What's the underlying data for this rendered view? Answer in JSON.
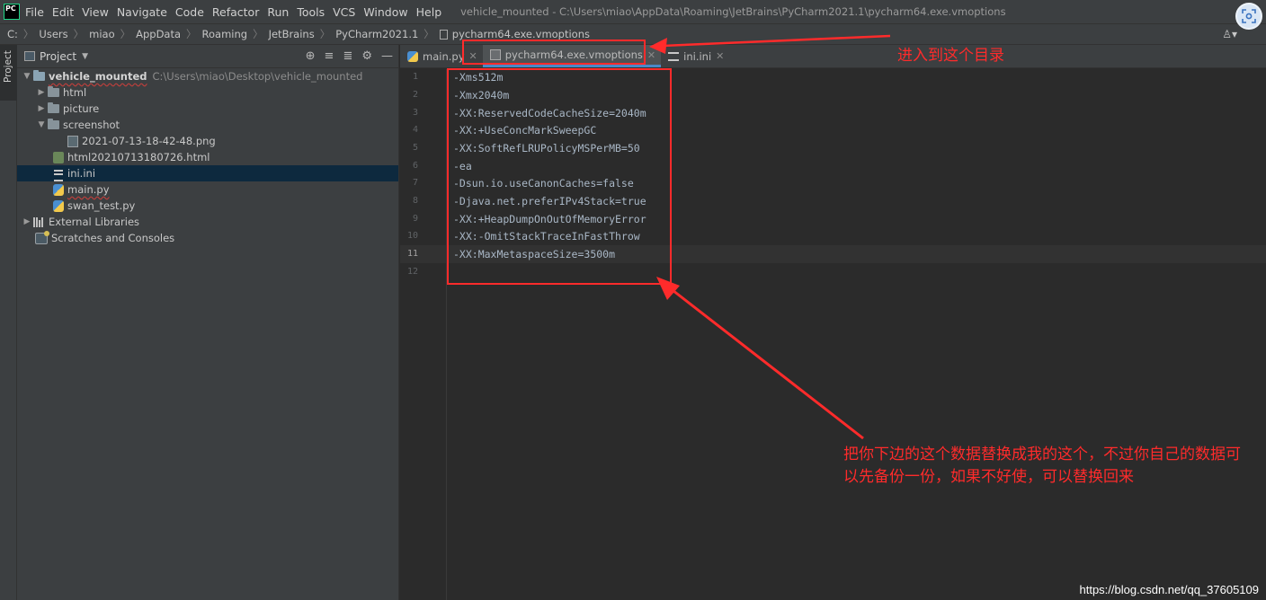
{
  "menubar": {
    "logo_text": "PC",
    "items": [
      "File",
      "Edit",
      "View",
      "Navigate",
      "Code",
      "Refactor",
      "Run",
      "Tools",
      "VCS",
      "Window",
      "Help"
    ],
    "window_title": "vehicle_mounted - C:\\Users\\miao\\AppData\\Roaming\\JetBrains\\PyCharm2021.1\\pycharm64.exe.vmoptions"
  },
  "breadcrumb": [
    "C:",
    "Users",
    "miao",
    "AppData",
    "Roaming",
    "JetBrains",
    "PyCharm2021.1",
    "pycharm64.exe.vmoptions"
  ],
  "tool_stripe": {
    "project_tab": "Project"
  },
  "project_panel": {
    "title": "Project",
    "root": {
      "name": "vehicle_mounted",
      "path": "C:\\Users\\miao\\Desktop\\vehicle_mounted"
    },
    "items": [
      {
        "label": "html",
        "type": "folder"
      },
      {
        "label": "picture",
        "type": "folder"
      },
      {
        "label": "screenshot",
        "type": "folder"
      },
      {
        "label": "2021-07-13-18-42-48.png",
        "type": "png"
      },
      {
        "label": "html20210713180726.html",
        "type": "html"
      },
      {
        "label": "ini.ini",
        "type": "ini"
      },
      {
        "label": "main.py",
        "type": "py"
      },
      {
        "label": "swan_test.py",
        "type": "py"
      },
      {
        "label": "External Libraries",
        "type": "lib"
      },
      {
        "label": "Scratches and Consoles",
        "type": "scratch"
      }
    ]
  },
  "tabs": [
    {
      "label": "main.py",
      "active": false
    },
    {
      "label": "pycharm64.exe.vmoptions",
      "active": true
    },
    {
      "label": "ini.ini",
      "active": false
    }
  ],
  "editor": {
    "current_line": 11,
    "lines": [
      "-Xms512m",
      "-Xmx2040m",
      "-XX:ReservedCodeCacheSize=2040m",
      "-XX:+UseConcMarkSweepGC",
      "-XX:SoftRefLRUPolicyMSPerMB=50",
      "-ea",
      "-Dsun.io.useCanonCaches=false",
      "-Djava.net.preferIPv4Stack=true",
      "-XX:+HeapDumpOnOutOfMemoryError",
      "-XX:-OmitStackTraceInFastThrow",
      "-XX:MaxMetaspaceSize=3500m",
      ""
    ],
    "line_numbers": [
      "1",
      "2",
      "3",
      "4",
      "5",
      "6",
      "7",
      "8",
      "9",
      "10",
      "11",
      "12"
    ]
  },
  "annotations": {
    "tab_note": "进入到这个目录",
    "code_note": "把你下边的这个数据替换成我的这个，不过你自己的数据可以先备份一份，如果不好使，可以替换回来",
    "color": "#ff2b2b"
  },
  "watermark": "https://blog.csdn.net/qq_37605109",
  "colors": {
    "accent": "#4a88c7",
    "selection": "#0d293e",
    "code_text": "#a9b7c6"
  }
}
